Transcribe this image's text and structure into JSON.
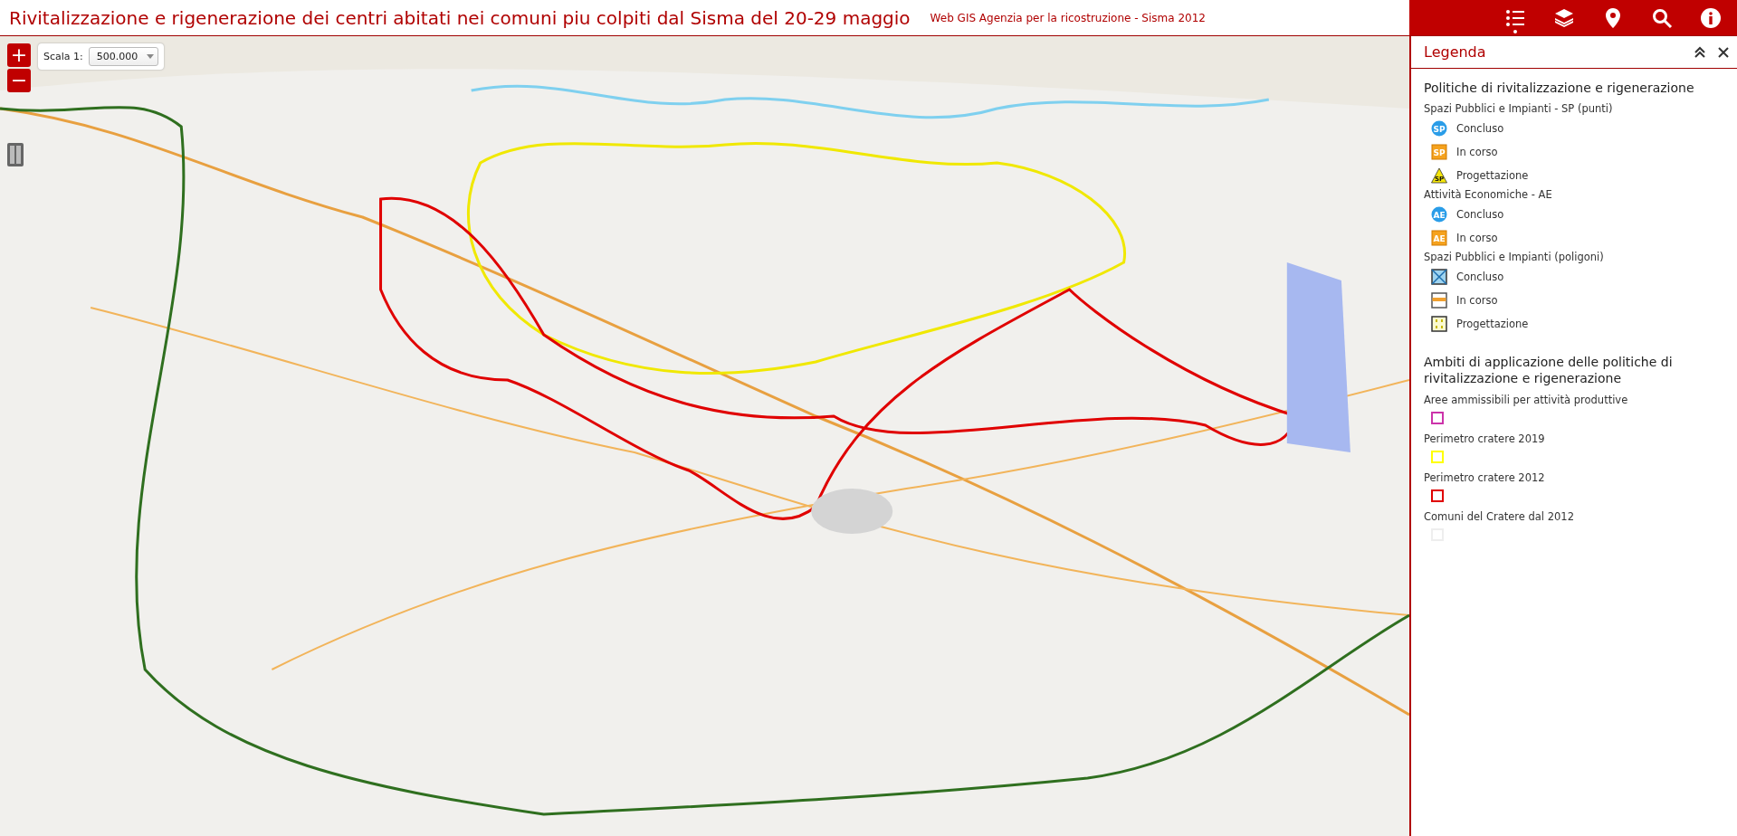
{
  "header": {
    "title": "Rivitalizzazione e rigenerazione dei centri abitati nei comuni piu colpiti dal Sisma del 20-29 maggio",
    "subtitle": "Web GIS Agenzia per la ricostruzione - Sisma 2012"
  },
  "toolbar": [
    {
      "selected": true
    },
    {
      "selected": false
    },
    {
      "selected": false
    },
    {
      "selected": false
    },
    {
      "selected": false
    }
  ],
  "map": {
    "zoom_in": "+",
    "zoom_out": "−",
    "scale_label": "Scala 1:",
    "scale_value": "500.000"
  },
  "legend": {
    "title": "Legenda",
    "sections": [
      {
        "heading": "Politiche di rivitalizzazione e rigenerazione",
        "groups": [
          {
            "label": "Spazi Pubblici e Impianti - SP (punti)",
            "items": [
              {
                "kind": "circle",
                "badge": "SP",
                "label": "Concluso"
              },
              {
                "kind": "square",
                "badge": "SP",
                "label": "In corso"
              },
              {
                "kind": "triangle",
                "badge": "SP",
                "label": "Progettazione"
              }
            ]
          },
          {
            "label": "Attività Economiche - AE",
            "items": [
              {
                "kind": "circle",
                "badge": "AE",
                "label": "Concluso"
              },
              {
                "kind": "square",
                "badge": "AE",
                "label": "In corso"
              }
            ]
          },
          {
            "label": "Spazi Pubblici e Impianti (poligoni)",
            "items": [
              {
                "kind": "poly-cross",
                "label": "Concluso"
              },
              {
                "kind": "poly-band",
                "label": "In corso"
              },
              {
                "kind": "poly-dots",
                "label": "Progettazione"
              }
            ]
          }
        ]
      },
      {
        "heading": "Ambiti di applicazione delle politiche di rivitalizzazione e rigenerazione",
        "groups": [
          {
            "label": "Aree ammissibili per attività produttive",
            "items": [
              {
                "kind": "swatch",
                "color": "#cc33aa"
              }
            ]
          },
          {
            "label": "Perimetro cratere 2019",
            "items": [
              {
                "kind": "swatch",
                "color": "#ffff00"
              }
            ]
          },
          {
            "label": "Perimetro cratere 2012",
            "items": [
              {
                "kind": "swatch",
                "color": "#e00000"
              }
            ]
          },
          {
            "label": "Comuni del Cratere dal 2012",
            "items": [
              {
                "kind": "swatch",
                "color": "#eeeeee"
              }
            ]
          }
        ]
      }
    ]
  }
}
